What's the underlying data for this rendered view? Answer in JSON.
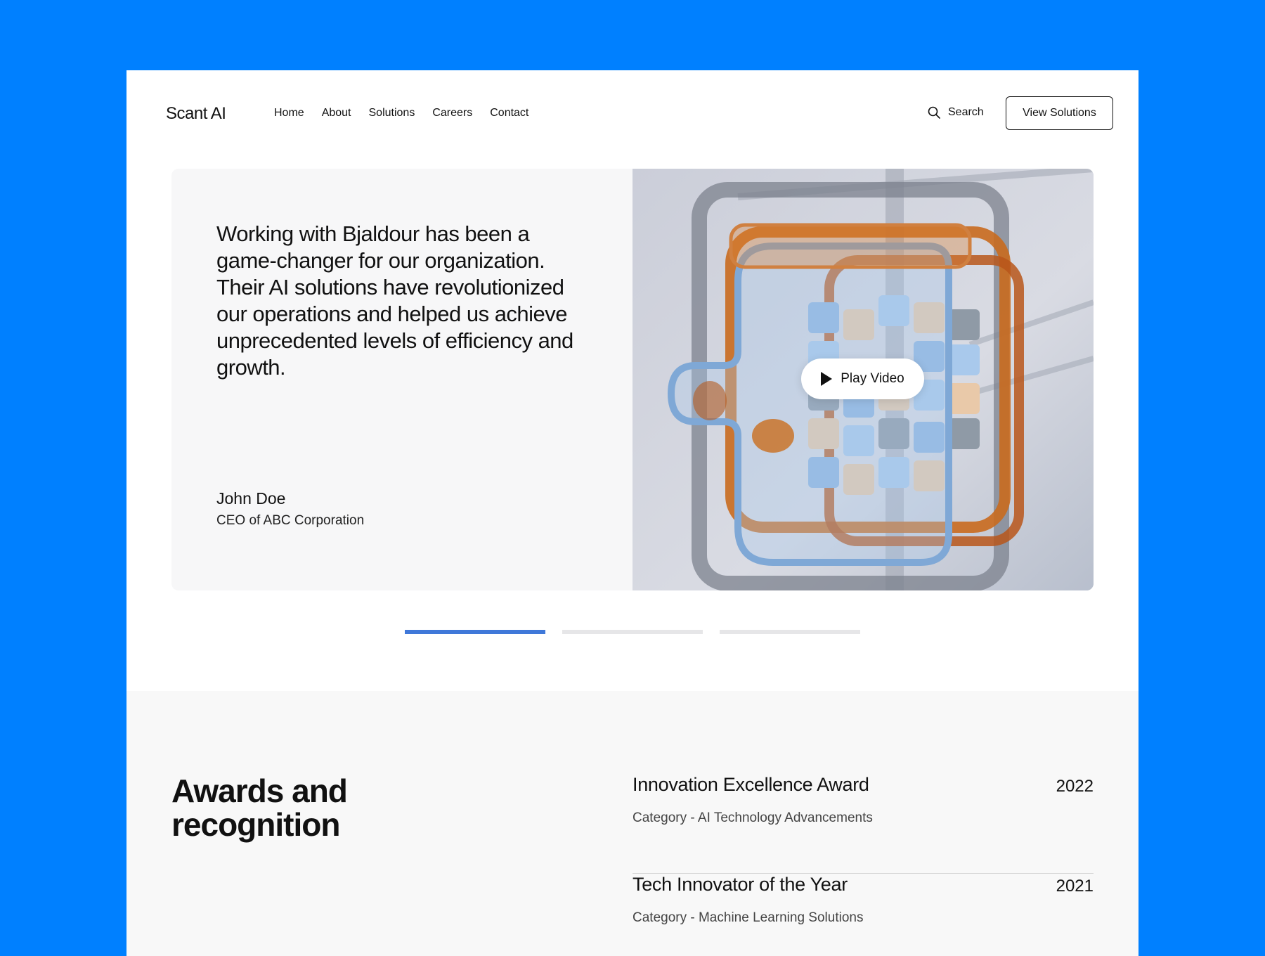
{
  "header": {
    "logo": "Scant AI",
    "nav": [
      "Home",
      "About",
      "Solutions",
      "Careers",
      "Contact"
    ],
    "search_label": "Search",
    "cta_label": "View Solutions"
  },
  "testimonial": {
    "quote": "Working with Bjaldour has been a game-changer for our organization. Their AI solutions have revolutionized our operations and helped us achieve unprecedented levels of efficiency and growth.",
    "author_name": "John Doe",
    "author_role": "CEO of ABC Corporation",
    "play_label": "Play Video"
  },
  "pager": {
    "count": 3,
    "active_index": 0
  },
  "awards": {
    "title": "Awards and recognition",
    "items": [
      {
        "name": "Innovation Excellence Award",
        "category": "Category - AI Technology Advancements",
        "year": "2022"
      },
      {
        "name": "Tech Innovator of the Year",
        "category": "Category - Machine Learning Solutions",
        "year": "2021"
      }
    ]
  },
  "colors": {
    "background": "#0080FF",
    "pager_active": "#3F78D9",
    "pager_inactive": "#E6E6E8"
  },
  "icons": {
    "search": "search-icon",
    "play": "play-icon"
  }
}
